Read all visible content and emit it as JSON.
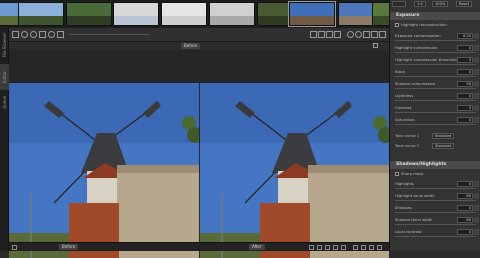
{
  "toolbar": {
    "mode_pill": "Before"
  },
  "sidebar_tabs": [
    "File Browser",
    "Editor",
    "Queue"
  ],
  "panel": {
    "top": {
      "ratio": "1:4",
      "zoom": "100%",
      "reset_label": "Reset"
    },
    "exposure": {
      "title": "Exposure",
      "highlight_recon_label": "Highlight reconstruction",
      "rows": [
        {
          "label": "Exposure compensation",
          "value": "0.00"
        },
        {
          "label": "Highlight compression",
          "value": "0"
        },
        {
          "label": "Highlight compression threshold",
          "value": "0"
        },
        {
          "label": "Black",
          "value": "0"
        },
        {
          "label": "Shadow compression",
          "value": "50"
        },
        {
          "label": "Lightness",
          "value": "0"
        },
        {
          "label": "Contrast",
          "value": "0"
        },
        {
          "label": "Saturation",
          "value": "0"
        }
      ],
      "curve1_label": "Tone curve 1",
      "curve1_mode": "Standard",
      "curve2_label": "Tone curve 2",
      "curve2_mode": "Standard"
    },
    "shadows": {
      "title": "Shadows/Highlights",
      "sharp_mask_label": "Sharp mask",
      "rows": [
        {
          "label": "Highlights",
          "value": "0"
        },
        {
          "label": "Highlight tonal width",
          "value": "80"
        },
        {
          "label": "Shadows",
          "value": "0"
        },
        {
          "label": "Shadow tonal width",
          "value": "80"
        },
        {
          "label": "Local contrast",
          "value": "0"
        }
      ]
    }
  },
  "bottom": {
    "left_label": "Before",
    "right_label": "After"
  }
}
